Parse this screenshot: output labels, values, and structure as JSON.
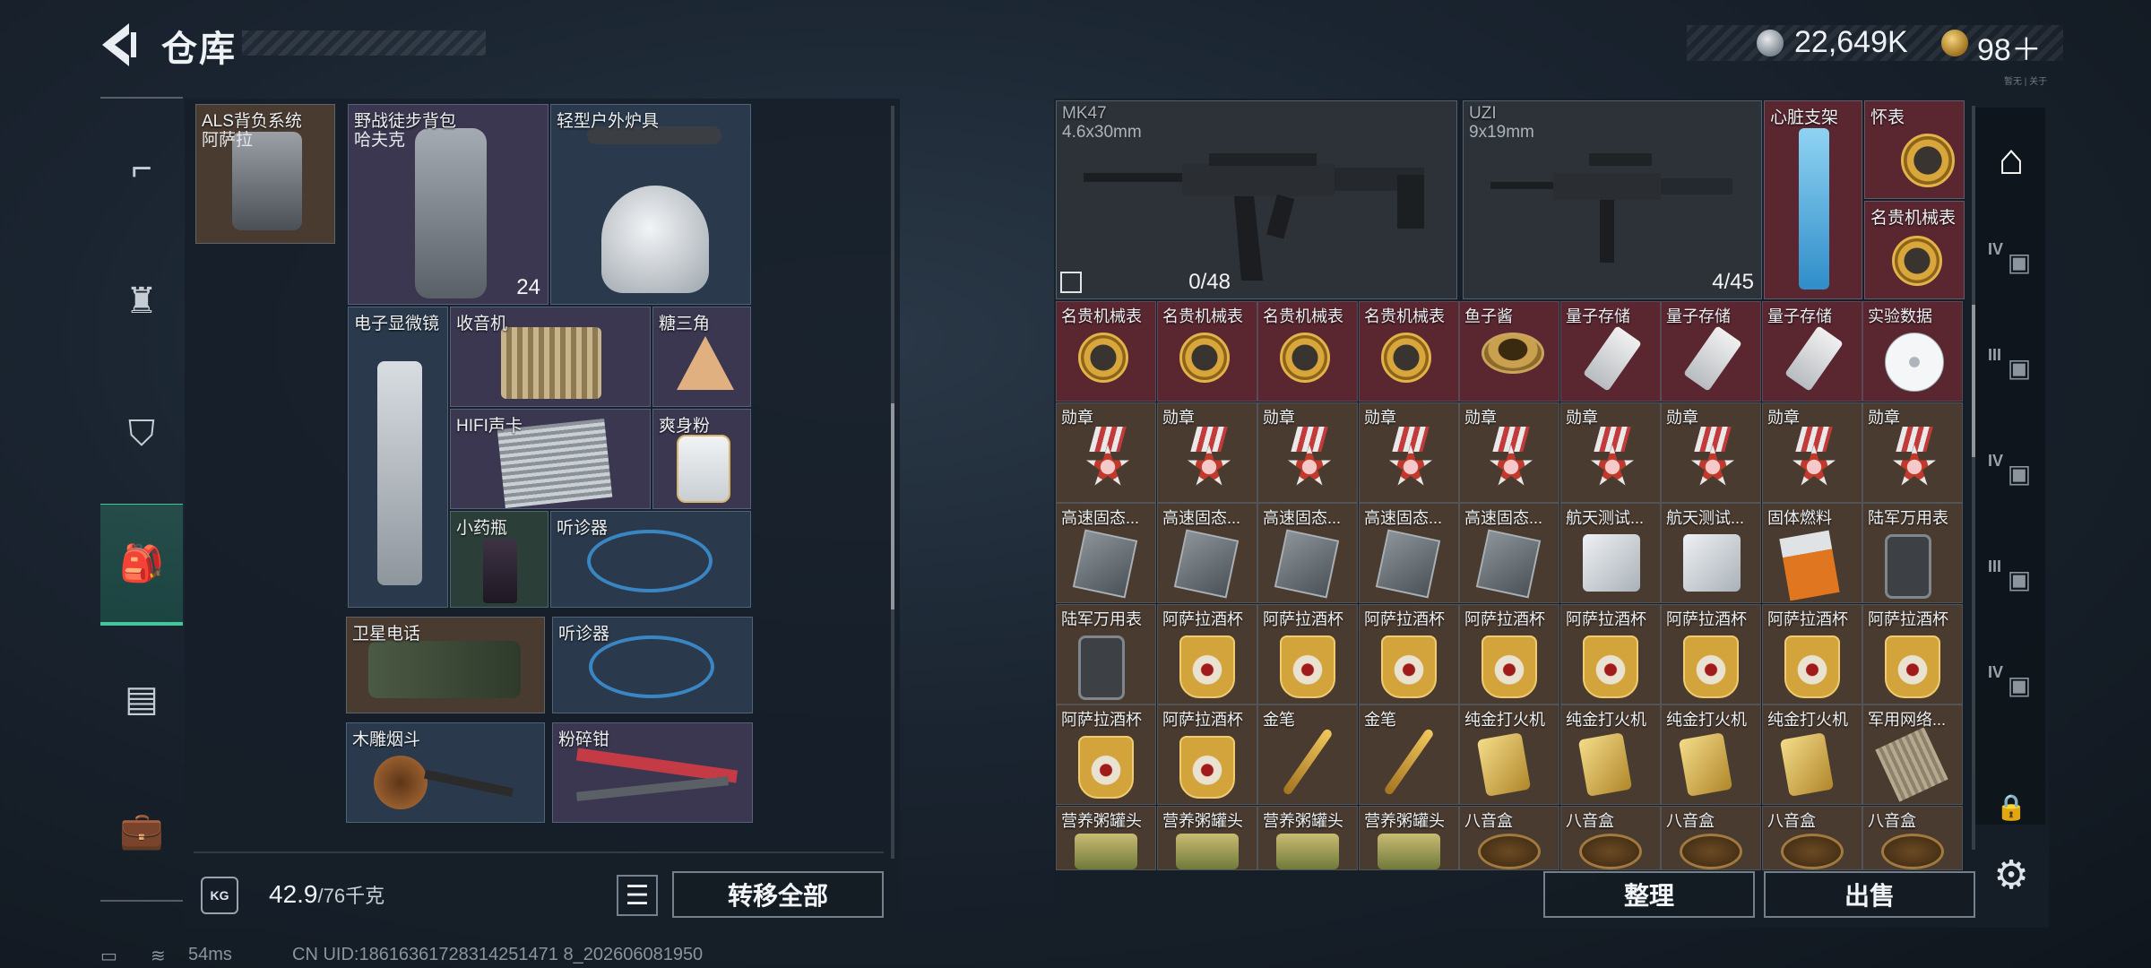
{
  "header": {
    "title": "仓库",
    "silver_amount": "22,649K",
    "gold_amount": "98＋",
    "tiny_tag": "暂无 | 关于"
  },
  "left_nav": [
    "gun-icon",
    "vest-icon",
    "armor-icon",
    "backpack-icon",
    "chest-rig-icon",
    "case-icon"
  ],
  "left_items": [
    {
      "name": "ALS背负系统",
      "sub": "阿萨拉",
      "rarity": "brown"
    },
    {
      "name": "野战徒步背包",
      "sub": "哈夫克",
      "count": "24",
      "rarity": "purple"
    },
    {
      "name": "轻型户外炉具",
      "rarity": "blue"
    },
    {
      "name": "电子显微镜",
      "rarity": "blue"
    },
    {
      "name": "收音机",
      "rarity": "purple"
    },
    {
      "name": "糖三角",
      "rarity": "purple"
    },
    {
      "name": "HIFI声卡",
      "rarity": "purple"
    },
    {
      "name": "爽身粉",
      "rarity": "purple"
    },
    {
      "name": "小药瓶",
      "rarity": "green"
    },
    {
      "name": "听诊器",
      "rarity": "blue"
    },
    {
      "name": "卫星电话",
      "rarity": "brown"
    },
    {
      "name": "听诊器",
      "rarity": "blue"
    },
    {
      "name": "木雕烟斗",
      "rarity": "blue"
    },
    {
      "name": "粉碎钳",
      "rarity": "purple"
    }
  ],
  "left_footer": {
    "kg_label": "KG",
    "weight_current": "42.9",
    "weight_max": "/76千克",
    "transfer_all": "转移全部"
  },
  "weapons": [
    {
      "name": "MK47",
      "caliber": "4.6x30mm",
      "ammo": "0/48"
    },
    {
      "name": "UZI",
      "caliber": "9x19mm",
      "ammo": "4/45"
    }
  ],
  "right_top_items": [
    {
      "name": "心脏支架"
    },
    {
      "name": "怀表"
    },
    {
      "name": "名贵机械表"
    }
  ],
  "right_grid": [
    [
      {
        "name": "名贵机械表",
        "art": "watch",
        "c": "red"
      },
      {
        "name": "名贵机械表",
        "art": "watch",
        "c": "red"
      },
      {
        "name": "名贵机械表",
        "art": "watch",
        "c": "red"
      },
      {
        "name": "名贵机械表",
        "art": "watch",
        "c": "red"
      },
      {
        "name": "鱼子酱",
        "art": "caviar",
        "c": "red"
      },
      {
        "name": "量子存储",
        "art": "usb",
        "c": "red"
      },
      {
        "name": "量子存储",
        "art": "usb",
        "c": "red"
      },
      {
        "name": "量子存储",
        "art": "usb",
        "c": "red"
      },
      {
        "name": "实验数据",
        "art": "disc",
        "c": "red"
      }
    ],
    [
      {
        "name": "勋章",
        "art": "medal",
        "c": "brown"
      },
      {
        "name": "勋章",
        "art": "medal",
        "c": "brown"
      },
      {
        "name": "勋章",
        "art": "medal",
        "c": "brown"
      },
      {
        "name": "勋章",
        "art": "medal",
        "c": "brown"
      },
      {
        "name": "勋章",
        "art": "medal",
        "c": "brown"
      },
      {
        "name": "勋章",
        "art": "medal",
        "c": "brown"
      },
      {
        "name": "勋章",
        "art": "medal",
        "c": "brown"
      },
      {
        "name": "勋章",
        "art": "medal",
        "c": "brown"
      },
      {
        "name": "勋章",
        "art": "medal",
        "c": "brown"
      }
    ],
    [
      {
        "name": "高速固态...",
        "art": "ssd",
        "c": "brown"
      },
      {
        "name": "高速固态...",
        "art": "ssd",
        "c": "brown"
      },
      {
        "name": "高速固态...",
        "art": "ssd",
        "c": "brown"
      },
      {
        "name": "高速固态...",
        "art": "ssd",
        "c": "brown"
      },
      {
        "name": "高速固态...",
        "art": "ssd",
        "c": "brown"
      },
      {
        "name": "航天测试...",
        "art": "box-white",
        "c": "brown"
      },
      {
        "name": "航天测试...",
        "art": "box-white",
        "c": "brown"
      },
      {
        "name": "固体燃料",
        "art": "fuel",
        "c": "brown"
      },
      {
        "name": "陆军万用表",
        "art": "meter",
        "c": "brown"
      }
    ],
    [
      {
        "name": "陆军万用表",
        "art": "meter",
        "c": "brown"
      },
      {
        "name": "阿萨拉酒杯",
        "art": "cup",
        "c": "brown"
      },
      {
        "name": "阿萨拉酒杯",
        "art": "cup",
        "c": "brown"
      },
      {
        "name": "阿萨拉酒杯",
        "art": "cup",
        "c": "brown"
      },
      {
        "name": "阿萨拉酒杯",
        "art": "cup",
        "c": "brown"
      },
      {
        "name": "阿萨拉酒杯",
        "art": "cup",
        "c": "brown"
      },
      {
        "name": "阿萨拉酒杯",
        "art": "cup",
        "c": "brown"
      },
      {
        "name": "阿萨拉酒杯",
        "art": "cup",
        "c": "brown"
      },
      {
        "name": "阿萨拉酒杯",
        "art": "cup",
        "c": "brown"
      }
    ],
    [
      {
        "name": "阿萨拉酒杯",
        "art": "cup",
        "c": "brown"
      },
      {
        "name": "阿萨拉酒杯",
        "art": "cup",
        "c": "brown"
      },
      {
        "name": "金笔",
        "art": "pen",
        "c": "brown"
      },
      {
        "name": "金笔",
        "art": "pen",
        "c": "brown"
      },
      {
        "name": "纯金打火机",
        "art": "lighter",
        "c": "brown"
      },
      {
        "name": "纯金打火机",
        "art": "lighter",
        "c": "brown"
      },
      {
        "name": "纯金打火机",
        "art": "lighter",
        "c": "brown"
      },
      {
        "name": "纯金打火机",
        "art": "lighter",
        "c": "brown"
      },
      {
        "name": "军用网络...",
        "art": "net",
        "c": "brown"
      }
    ],
    [
      {
        "name": "营养粥罐头",
        "art": "can",
        "c": "brown"
      },
      {
        "name": "营养粥罐头",
        "art": "can",
        "c": "brown"
      },
      {
        "name": "营养粥罐头",
        "art": "can",
        "c": "brown"
      },
      {
        "name": "营养粥罐头",
        "art": "can",
        "c": "brown"
      },
      {
        "name": "八音盒",
        "art": "musicbox",
        "c": "brown"
      },
      {
        "name": "八音盒",
        "art": "musicbox",
        "c": "brown"
      },
      {
        "name": "八音盒",
        "art": "musicbox",
        "c": "brown"
      },
      {
        "name": "八音盒",
        "art": "musicbox",
        "c": "brown"
      },
      {
        "name": "八音盒",
        "art": "musicbox",
        "c": "brown"
      }
    ]
  ],
  "right_footer": {
    "sort": "整理",
    "sell": "出售"
  },
  "right_sidebar": {
    "tiers": [
      "IV",
      "III",
      "IV",
      "III",
      "IV"
    ],
    "lock_icon": "lock-icon",
    "settings_icon": "gear-icon"
  },
  "status_bar": {
    "ping": "54ms",
    "uid": "CN UID:18616361728314251471 8_202606081950"
  },
  "colors": {
    "accent": "#45c59a",
    "rarity_red": "#5a2630",
    "rarity_brown": "#4a3b30",
    "rarity_purple": "#3b3750",
    "rarity_blue": "#2a3a4c"
  }
}
